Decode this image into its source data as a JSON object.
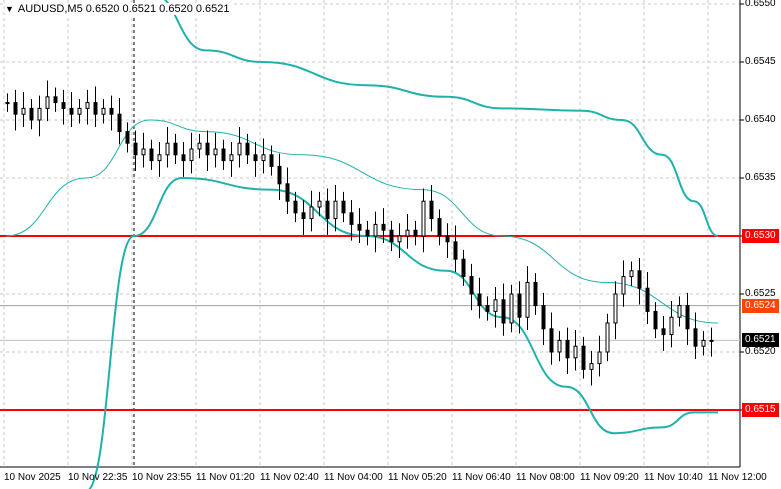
{
  "header": {
    "symbol": "AUDUSD,M5",
    "ohlc": "0.6520 0.6521 0.6520 0.6521"
  },
  "chart_data": {
    "type": "candlestick",
    "title": "AUDUSD,M5",
    "ylim": [
      0.65095,
      0.65505
    ],
    "y_ticks": [
      "0.6550",
      "0.6545",
      "0.6540",
      "0.6535",
      "0.6530",
      "0.6525",
      "0.6520",
      "0.6515"
    ],
    "x_ticks": [
      "10 Nov 2025",
      "10 Nov 22:35",
      "10 Nov 23:55",
      "11 Nov 01:20",
      "11 Nov 02:40",
      "11 Nov 04:00",
      "11 Nov 05:20",
      "11 Nov 06:40",
      "11 Nov 08:00",
      "11 Nov 09:20",
      "11 Nov 10:40",
      "11 Nov 12:00"
    ],
    "closes": [
      0.65415,
      0.65405,
      0.6541,
      0.654,
      0.6541,
      0.6542,
      0.65415,
      0.6541,
      0.65405,
      0.6541,
      0.65415,
      0.65405,
      0.6541,
      0.65405,
      0.6539,
      0.6538,
      0.6537,
      0.65375,
      0.65365,
      0.6537,
      0.6538,
      0.6537,
      0.65365,
      0.65375,
      0.6538,
      0.6537,
      0.65375,
      0.65365,
      0.6537,
      0.6538,
      0.6537,
      0.65365,
      0.6537,
      0.6536,
      0.65345,
      0.6533,
      0.6532,
      0.65315,
      0.65325,
      0.6533,
      0.65315,
      0.6533,
      0.6532,
      0.6531,
      0.65305,
      0.653,
      0.6531,
      0.65305,
      0.65295,
      0.653,
      0.65305,
      0.653,
      0.6533,
      0.65315,
      0.653,
      0.65295,
      0.6528,
      0.65265,
      0.6525,
      0.6524,
      0.65235,
      0.65245,
      0.65225,
      0.6525,
      0.6523,
      0.6526,
      0.6524,
      0.6522,
      0.652,
      0.6521,
      0.65195,
      0.65205,
      0.65185,
      0.6519,
      0.652,
      0.65225,
      0.6525,
      0.65265,
      0.6527,
      0.65255,
      0.65235,
      0.6522,
      0.65215,
      0.6523,
      0.6524,
      0.6522,
      0.65205,
      0.6521,
      0.6521
    ],
    "bollinger_upper": [
      [
        18,
        0.6551
      ],
      [
        25,
        0.6546
      ],
      [
        32,
        0.6545
      ],
      [
        45,
        0.6543
      ],
      [
        55,
        0.6542
      ],
      [
        62,
        0.6541
      ],
      [
        72,
        0.65408
      ],
      [
        77,
        0.654
      ],
      [
        82,
        0.6537
      ],
      [
        86,
        0.6533
      ],
      [
        89,
        0.653
      ]
    ],
    "bollinger_middle": [
      [
        0,
        0.653
      ],
      [
        10,
        0.6535
      ],
      [
        18,
        0.654
      ],
      [
        25,
        0.6539
      ],
      [
        37,
        0.6537
      ],
      [
        52,
        0.6534
      ],
      [
        62,
        0.653
      ],
      [
        75,
        0.6526
      ],
      [
        89,
        0.65225
      ]
    ],
    "bollinger_lower": [
      [
        10,
        0.6508
      ],
      [
        16,
        0.653
      ],
      [
        22,
        0.6535
      ],
      [
        33,
        0.6534
      ],
      [
        45,
        0.653
      ],
      [
        55,
        0.6527
      ],
      [
        62,
        0.6523
      ],
      [
        70,
        0.6517
      ],
      [
        76,
        0.6513
      ],
      [
        82,
        0.65135
      ],
      [
        86,
        0.65148
      ],
      [
        89,
        0.65148
      ]
    ],
    "hlines": [
      {
        "price": 0.653,
        "label": "0.6530",
        "color": "#ff0000"
      },
      {
        "price": 0.6515,
        "label": "0.6515",
        "color": "#ff0000"
      },
      {
        "price": 0.6524,
        "label": "0.6524",
        "color": "#ff4500"
      },
      {
        "price": 0.6521,
        "label": "0.6521",
        "color": "#000000"
      }
    ],
    "band_color": "#20b2aa"
  }
}
